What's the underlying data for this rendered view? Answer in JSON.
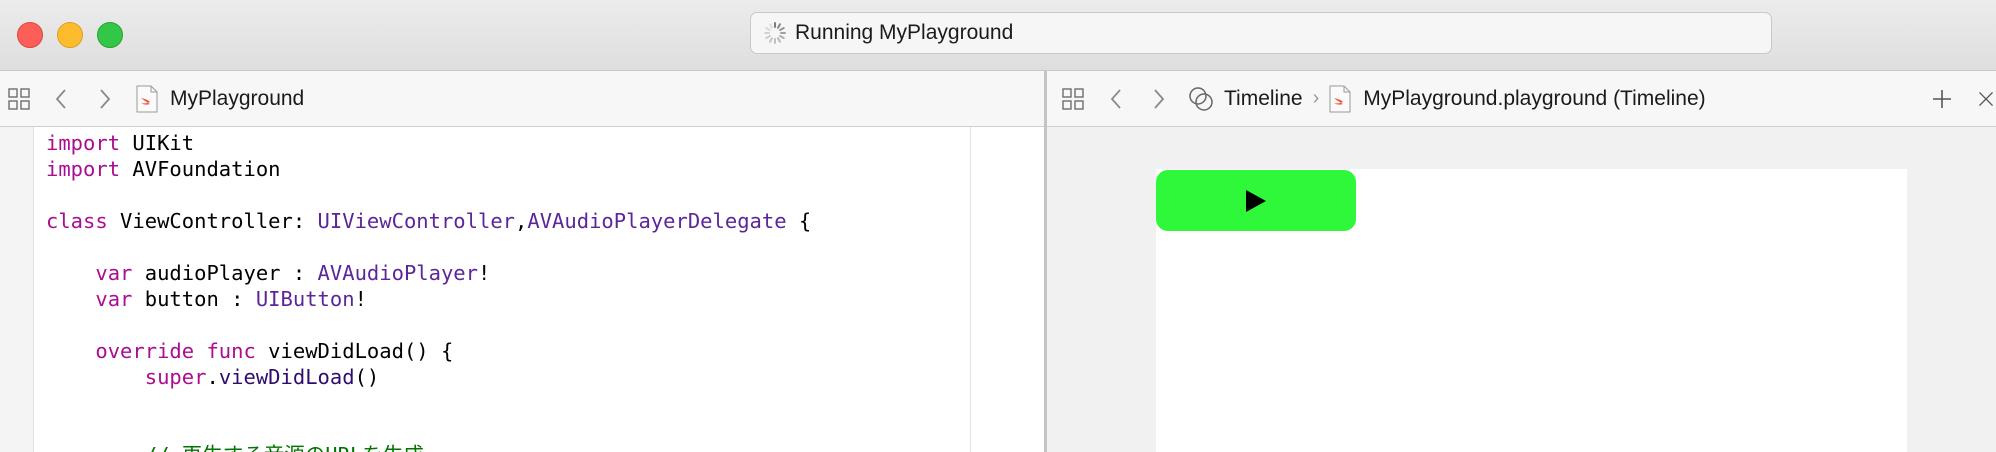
{
  "window": {
    "activity_text": "Running MyPlayground"
  },
  "left_editor": {
    "file_name": "MyPlayground",
    "icons": [
      "related-items-icon",
      "back-chevron-icon",
      "forward-chevron-icon",
      "swift-file-icon"
    ]
  },
  "right_editor": {
    "breadcrumb_root": "Timeline",
    "breadcrumb_file": "MyPlayground.playground (Timeline)",
    "icons": [
      "related-items-icon",
      "back-chevron-icon",
      "forward-chevron-icon",
      "assistant-rings-icon",
      "swift-file-icon",
      "add-icon",
      "close-icon"
    ]
  },
  "code": {
    "lines": [
      [
        {
          "t": "import",
          "c": "kw"
        },
        {
          "t": " UIKit",
          "c": ""
        }
      ],
      [
        {
          "t": "import",
          "c": "kw"
        },
        {
          "t": " AVFoundation",
          "c": ""
        }
      ],
      [],
      [
        {
          "t": "class",
          "c": "kw"
        },
        {
          "t": " ViewController: ",
          "c": ""
        },
        {
          "t": "UIViewController",
          "c": "ty"
        },
        {
          "t": ",",
          "c": ""
        },
        {
          "t": "AVAudioPlayerDelegate",
          "c": "ty"
        },
        {
          "t": " {",
          "c": ""
        }
      ],
      [],
      [
        {
          "t": "    ",
          "c": ""
        },
        {
          "t": "var",
          "c": "kw"
        },
        {
          "t": " audioPlayer : ",
          "c": ""
        },
        {
          "t": "AVAudioPlayer",
          "c": "ty"
        },
        {
          "t": "!",
          "c": ""
        }
      ],
      [
        {
          "t": "    ",
          "c": ""
        },
        {
          "t": "var",
          "c": "kw"
        },
        {
          "t": " button : ",
          "c": ""
        },
        {
          "t": "UIButton",
          "c": "ty"
        },
        {
          "t": "!",
          "c": ""
        }
      ],
      [],
      [
        {
          "t": "    ",
          "c": ""
        },
        {
          "t": "override",
          "c": "kw"
        },
        {
          "t": " ",
          "c": ""
        },
        {
          "t": "func",
          "c": "kw"
        },
        {
          "t": " viewDidLoad() {",
          "c": ""
        }
      ],
      [
        {
          "t": "        ",
          "c": ""
        },
        {
          "t": "super",
          "c": "kw"
        },
        {
          "t": ".",
          "c": ""
        },
        {
          "t": "viewDidLoad",
          "c": "fn"
        },
        {
          "t": "()",
          "c": ""
        }
      ],
      [],
      [],
      [
        {
          "t": "        ",
          "c": ""
        },
        {
          "t": "// 再生する音源のURLを生成",
          "c": "cm"
        }
      ]
    ]
  },
  "live_view": {
    "play_button_symbol": "▶",
    "button_color": "#2ff83a"
  }
}
